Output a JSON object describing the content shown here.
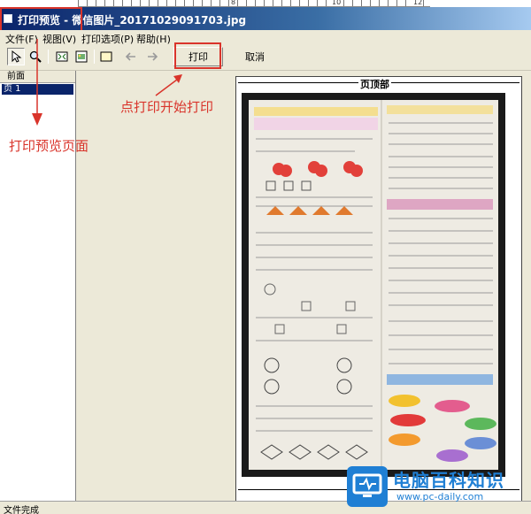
{
  "ruler": {
    "numbers": [
      "8",
      "10",
      "12"
    ]
  },
  "window": {
    "title": "打印预览 - 微信图片_20171029091703.jpg"
  },
  "menu": {
    "items": [
      "文件(F)",
      "视图(V)",
      "打印选项(P)",
      "帮助(H)"
    ]
  },
  "toolbar": {
    "icons": [
      "select-arrow-icon",
      "zoom-icon",
      "fit-page-icon",
      "fit-width-icon",
      "page-icon",
      "back-arrow-icon",
      "forward-arrow-icon"
    ],
    "print_label": "打印",
    "cancel_label": "取消"
  },
  "left_panel": {
    "header": "前面",
    "pages": [
      "页 1"
    ]
  },
  "preview": {
    "header_label": "页顶部"
  },
  "annotations": {
    "print_hint": "点打印开始打印",
    "preview_hint": "打印预览页面",
    "color": "#d9342b"
  },
  "statusbar": {
    "text": "文件完成"
  },
  "watermark": {
    "title": "电脑百科知识",
    "url": "www.pc-daily.com",
    "color": "#1f7fd4"
  },
  "colors": {
    "titlebar": "#0a246a",
    "chrome": "#ece9d8",
    "selected": "#0a246a"
  }
}
